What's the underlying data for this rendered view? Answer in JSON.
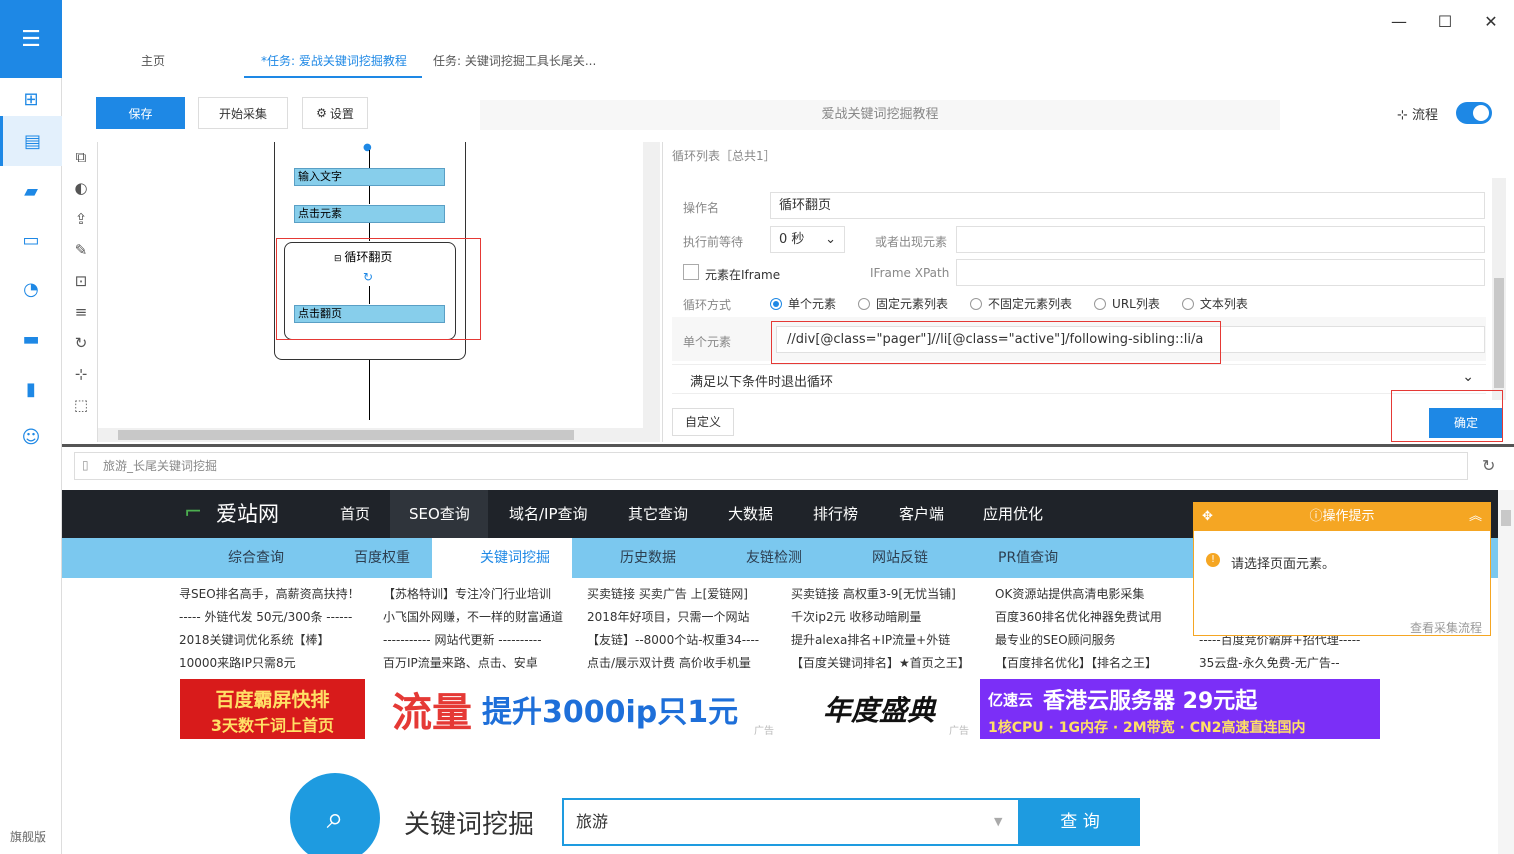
{
  "sidebar": {
    "edition": "旗舰版"
  },
  "tabs": [
    "主页",
    "*任务: 爱战关键词挖掘教程",
    "任务: 关键词挖掘工具长尾关..."
  ],
  "toolbar": {
    "save": "保存",
    "start": "开始采集",
    "settings": "设置",
    "task_title": "爱战关键词挖掘教程",
    "flow": "流程"
  },
  "flow": {
    "input_text": "输入文字",
    "click_element": "点击元素",
    "loop_title": "循环翻页",
    "click_page": "点击翻页"
  },
  "props": {
    "header": "循环列表［总共1］",
    "op_name_label": "操作名",
    "op_name": "循环翻页",
    "wait_label": "执行前等待",
    "wait_value": "0 秒",
    "or_appear_label": "或者出现元素",
    "iframe_label": "元素在Iframe",
    "iframe_xpath_label": "IFrame XPath",
    "loop_mode_label": "循环方式",
    "modes": [
      "单个元素",
      "固定元素列表",
      "不固定元素列表",
      "URL列表",
      "文本列表"
    ],
    "single_label": "单个元素",
    "xpath": "//div[@class=\"pager\"]//li[@class=\"active\"]/following-sibling::li/a",
    "exit_cond": "满足以下条件时退出循环",
    "custom": "自定义",
    "ok": "确定"
  },
  "browser": {
    "url": "旅游_长尾关键词挖掘"
  },
  "web": {
    "logo": "爱站网",
    "nav": [
      "首页",
      "SEO查询",
      "域名/IP查询",
      "其它查询",
      "大数据",
      "排行榜",
      "客户端",
      "应用优化"
    ],
    "sub": [
      "综合查询",
      "百度权重",
      "关键词挖掘",
      "历史数据",
      "友链检测",
      "网站反链",
      "PR值查询"
    ],
    "ads": [
      [
        "寻SEO排名高手，高薪资高扶持！",
        "----- 外链代发 50元/300条 ------",
        "2018关键词优化系统【棒】",
        "10000来路IP只需8元"
      ],
      [
        "【苏格特训】专注冷门行业培训",
        "小飞国外网赚，不一样的财富通道",
        "----------- 网站代更新 ----------",
        "百万IP流量来路、点击、安卓"
      ],
      [
        "买卖链接 买卖广告 上[爱链网]",
        "2018年好项目，只需一个网站",
        "【友链】--8000个站-权重34----",
        "点击/展示双计费 高价收手机量"
      ],
      [
        "买卖链接 高权重3-9[无忧当铺]",
        "千次ip2元 收移动暗刷量",
        "提升alexa排名+IP流量+外链",
        "【百度关键词排名】★首页之王】"
      ],
      [
        "OK资源站提供高清电影采集",
        "百度360排名优化神器免费试用",
        "最专业的SEO顾问服务",
        "【百度排名优化】【排名之王】"
      ],
      [
        "",
        "",
        "-----百度竞价霸屏+招代理-----",
        "35云盘-永久免费-无广告--"
      ]
    ],
    "banner1": [
      "百度霸屏快排",
      "3天数千词上首页"
    ],
    "banner2": [
      "流量",
      "提升3000ip只1元"
    ],
    "banner3": "年度盛典",
    "banner4": [
      "亿速云",
      "香港云服务器 29元起",
      "1核CPU · 1G内存 · 2M带宽 · CN2高速直连国内"
    ],
    "ad_tag": "广告",
    "search_title": "关键词挖掘",
    "search_value": "旅游",
    "search_btn": "查 询"
  },
  "tip": {
    "title": "操作提示",
    "message": "请选择页面元素。",
    "link": "查看采集流程"
  }
}
